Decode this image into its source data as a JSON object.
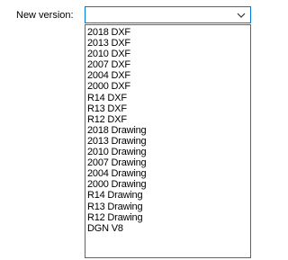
{
  "form": {
    "label": "New version:",
    "selected_value": ""
  },
  "dropdown": {
    "options": [
      "2018 DXF",
      "2013 DXF",
      "2010 DXF",
      "2007 DXF",
      "2004 DXF",
      "2000 DXF",
      "R14 DXF",
      "R13 DXF",
      "R12 DXF",
      "2018 Drawing",
      "2013 Drawing",
      "2010 Drawing",
      "2007 Drawing",
      "2004 Drawing",
      "2000 Drawing",
      "R14 Drawing",
      "R13 Drawing",
      "R12 Drawing",
      "DGN V8"
    ]
  },
  "icons": {
    "arrow": "chevron-down-icon"
  },
  "colors": {
    "focus_border": "#0078d7",
    "list_border": "#646464"
  }
}
